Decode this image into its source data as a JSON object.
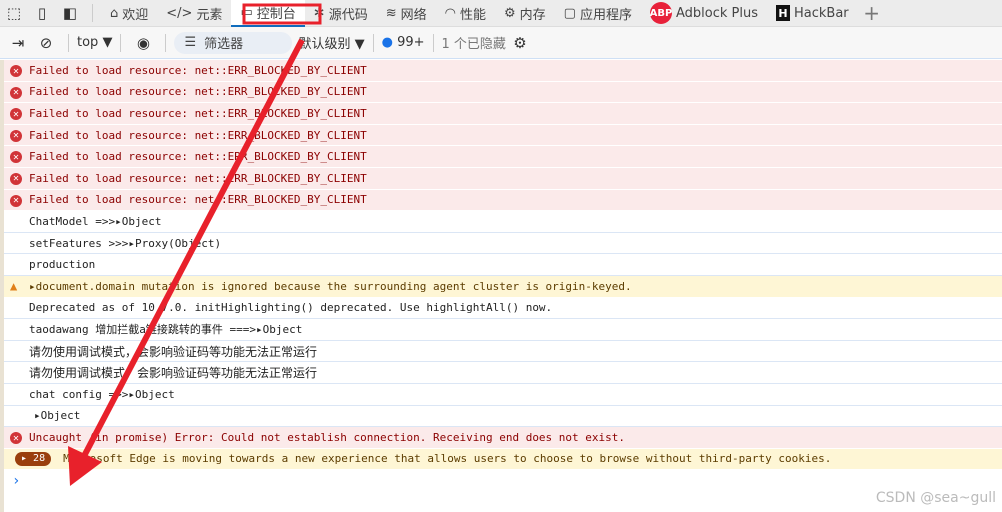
{
  "tabs": {
    "items": [
      {
        "label": "欢迎",
        "icon": "home-icon"
      },
      {
        "label": "元素",
        "icon": "code-icon"
      },
      {
        "label": "控制台",
        "icon": "console-icon",
        "active": true
      },
      {
        "label": "源代码",
        "icon": "bug-icon"
      },
      {
        "label": "网络",
        "icon": "wifi-icon"
      },
      {
        "label": "性能",
        "icon": "gauge-icon"
      },
      {
        "label": "内存",
        "icon": "chip-icon"
      },
      {
        "label": "应用程序",
        "icon": "window-icon"
      },
      {
        "label": "Adblock Plus",
        "icon": "abp-icon"
      },
      {
        "label": "HackBar",
        "icon": "hackbar-icon"
      }
    ],
    "abp_logo": "ABP",
    "hackbar_logo": "H",
    "add": "+"
  },
  "toolbar": {
    "context": "top",
    "filter_placeholder": "筛选器",
    "level": "默认级别",
    "issues_count": "99+",
    "hidden": "1 个已隐藏"
  },
  "console": {
    "errors": [
      "Failed to load resource: net::ERR_BLOCKED_BY_CLIENT",
      "Failed to load resource: net::ERR_BLOCKED_BY_CLIENT",
      "Failed to load resource: net::ERR_BLOCKED_BY_CLIENT",
      "Failed to load resource: net::ERR_BLOCKED_BY_CLIENT",
      "Failed to load resource: net::ERR_BLOCKED_BY_CLIENT",
      "Failed to load resource: net::ERR_BLOCKED_BY_CLIENT",
      "Failed to load resource: net::ERR_BLOCKED_BY_CLIENT"
    ],
    "chatmodel": {
      "text": "ChatModel =>> ",
      "obj": "Object"
    },
    "setfeatures": {
      "text": "setFeatures >>> ",
      "obj": "Proxy(Object)"
    },
    "production": "production",
    "warning": "document.domain mutation is ignored because the surrounding agent cluster is origin-keyed.",
    "deprecated": "Deprecated as of 10.7.0. initHighlighting() deprecated.  Use highlightAll() now.",
    "taodawang": {
      "text": "taodawang 增加拦截a链接跳转的事件 ===> ",
      "obj": "Object"
    },
    "debug1": "请勿使用调试模式，会影响验证码等功能无法正常运行",
    "debug2": "请勿使用调试模式，会影响验证码等功能无法正常运行",
    "chatconfig": {
      "text": "chat config =>> ",
      "obj": "Object"
    },
    "object": "Object",
    "uncaught": "Uncaught (in promise) Error: Could not establish connection. Receiving end does not exist.",
    "edge": {
      "count": "28",
      "text": "Microsoft Edge is moving towards a new experience that allows users to choose to browse without third-party cookies."
    },
    "prompt": "›"
  },
  "watermark": "CSDN @sea~gull",
  "colors": {
    "annotation": "#e8212b",
    "accent": "#0f6cbd",
    "error_bg": "#fbeaea",
    "warning_bg": "#fef6d5"
  }
}
